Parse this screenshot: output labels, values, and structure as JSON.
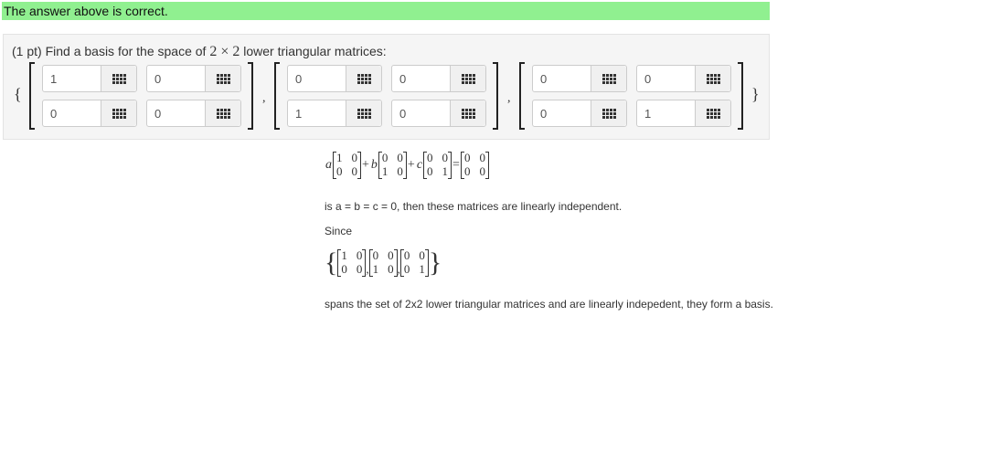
{
  "banner": {
    "text": "The answer above is correct."
  },
  "problem": {
    "prompt_prefix": "(1 pt) Find a basis for the space of ",
    "prompt_math": "2 × 2",
    "prompt_suffix": " lower triangular matrices:",
    "open_brace": "{",
    "close_brace": "}",
    "comma": ",",
    "matrices": [
      {
        "a11": "1",
        "a12": "0",
        "a21": "0",
        "a22": "0"
      },
      {
        "a11": "0",
        "a12": "0",
        "a21": "1",
        "a22": "0"
      },
      {
        "a11": "0",
        "a12": "0",
        "a21": "0",
        "a22": "1"
      }
    ]
  },
  "solution": {
    "equation": {
      "coef_a": "a",
      "coef_b": "b",
      "coef_c": "c",
      "plus": "+",
      "equals": "=",
      "m1": [
        [
          "1",
          "0"
        ],
        [
          "0",
          "0"
        ]
      ],
      "m2": [
        [
          "0",
          "0"
        ],
        [
          "1",
          "0"
        ]
      ],
      "m3": [
        [
          "0",
          "0"
        ],
        [
          "0",
          "1"
        ]
      ],
      "zero": [
        [
          "0",
          "0"
        ],
        [
          "0",
          "0"
        ]
      ]
    },
    "line1": "is a = b = c = 0, then these matrices are linearly independent.",
    "line2": "Since",
    "set_open": "{",
    "set_close": "}",
    "set_comma": ",",
    "line3": "spans the set of 2x2 lower triangular matrices and are linearly indepedent, they form a basis."
  }
}
